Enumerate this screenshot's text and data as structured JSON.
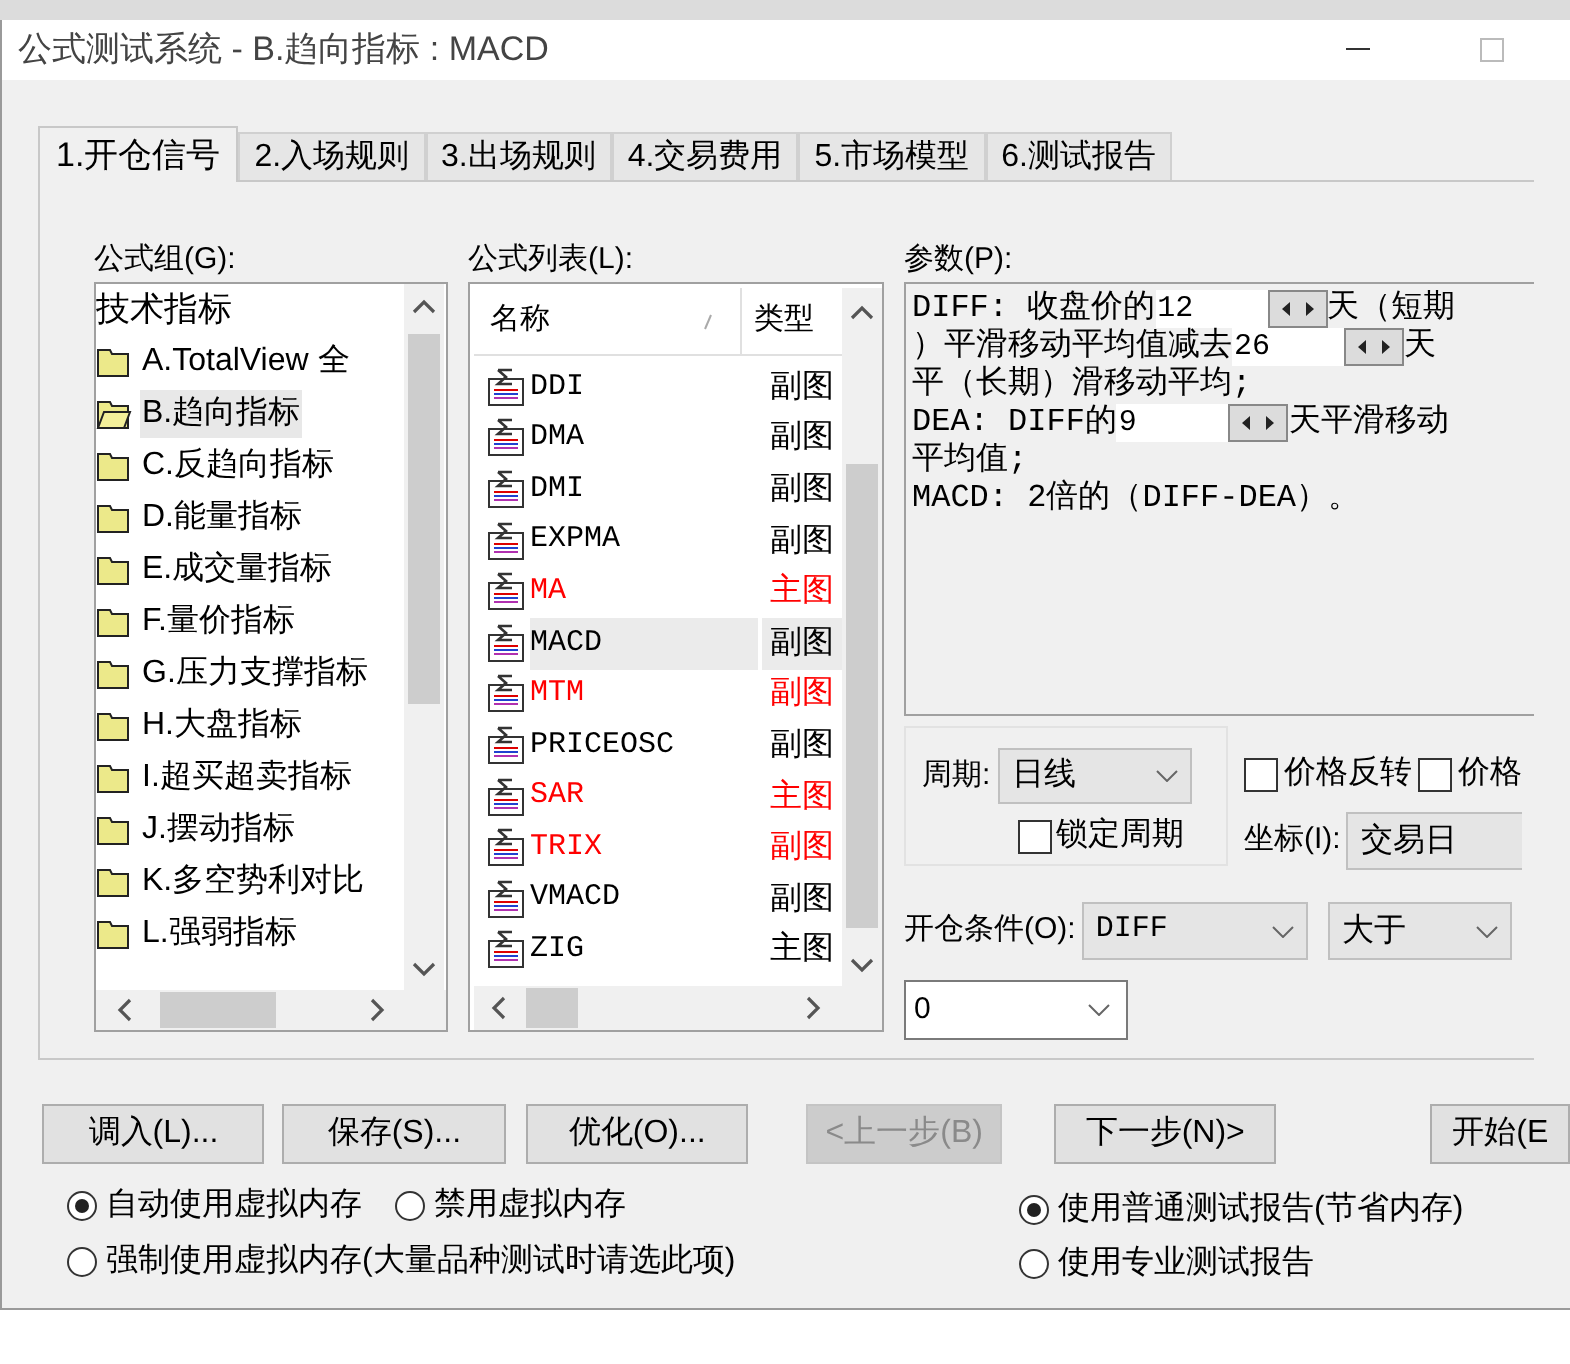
{
  "window": {
    "title": "公式测试系统 - B.趋向指标 : MACD"
  },
  "tabs": [
    {
      "label": "1.开仓信号",
      "selected": true
    },
    {
      "label": "2.入场规则",
      "selected": false
    },
    {
      "label": "3.出场规则",
      "selected": false
    },
    {
      "label": "4.交易费用",
      "selected": false
    },
    {
      "label": "5.市场模型",
      "selected": false
    },
    {
      "label": "6.测试报告",
      "selected": false
    }
  ],
  "formula_group": {
    "label": "公式组(G):",
    "header": "技术指标",
    "items": [
      {
        "label": "A.TotalView 全",
        "selected": false
      },
      {
        "label": "B.趋向指标",
        "selected": true
      },
      {
        "label": "C.反趋向指标",
        "selected": false
      },
      {
        "label": "D.能量指标",
        "selected": false
      },
      {
        "label": "E.成交量指标",
        "selected": false
      },
      {
        "label": "F.量价指标",
        "selected": false
      },
      {
        "label": "G.压力支撑指标",
        "selected": false
      },
      {
        "label": "H.大盘指标",
        "selected": false
      },
      {
        "label": "I.超买超卖指标",
        "selected": false
      },
      {
        "label": "J.摆动指标",
        "selected": false
      },
      {
        "label": "K.多空势利对比",
        "selected": false
      },
      {
        "label": "L.强弱指标",
        "selected": false
      }
    ]
  },
  "formula_list": {
    "label": "公式列表(L):",
    "columns": [
      "名称",
      "类型"
    ],
    "rows": [
      {
        "name": "DDI",
        "type": "副图",
        "color": "#000000",
        "selected": false
      },
      {
        "name": "DMA",
        "type": "副图",
        "color": "#000000",
        "selected": false
      },
      {
        "name": "DMI",
        "type": "副图",
        "color": "#000000",
        "selected": false
      },
      {
        "name": "EXPMA",
        "type": "副图",
        "color": "#000000",
        "selected": false
      },
      {
        "name": "MA",
        "type": "主图",
        "color": "#ff0000",
        "selected": false
      },
      {
        "name": "MACD",
        "type": "副图",
        "color": "#000000",
        "selected": true
      },
      {
        "name": "MTM",
        "type": "副图",
        "color": "#ff0000",
        "selected": false
      },
      {
        "name": "PRICEOSC",
        "type": "副图",
        "color": "#000000",
        "selected": false
      },
      {
        "name": "SAR",
        "type": "主图",
        "color": "#ff0000",
        "selected": false
      },
      {
        "name": "TRIX",
        "type": "副图",
        "color": "#ff0000",
        "selected": false
      },
      {
        "name": "VMACD",
        "type": "副图",
        "color": "#000000",
        "selected": false
      },
      {
        "name": "ZIG",
        "type": "主图",
        "color": "#000000",
        "selected": false
      }
    ]
  },
  "parameters": {
    "label": "参数(P):",
    "lines": [
      [
        {
          "kind": "text",
          "text": "DIFF: 收盘价的"
        },
        {
          "kind": "spin",
          "value": "12"
        },
        {
          "kind": "text",
          "text": "天（短期"
        }
      ],
      [
        {
          "kind": "text",
          "text": "）平滑移动平均值减去"
        },
        {
          "kind": "spin",
          "value": "26"
        },
        {
          "kind": "text",
          "text": "天"
        }
      ],
      [
        {
          "kind": "text",
          "text": "平（长期）滑移动平均;"
        }
      ],
      [
        {
          "kind": "text",
          "text": "DEA: DIFF的"
        },
        {
          "kind": "spin",
          "value": "9"
        },
        {
          "kind": "text",
          "text": "天平滑移动"
        }
      ],
      [
        {
          "kind": "text",
          "text": "平均值;"
        }
      ],
      [
        {
          "kind": "text",
          "text": "MACD: 2倍的（DIFF-DEA）。"
        }
      ]
    ]
  },
  "period": {
    "label": "周期:",
    "value": "日线",
    "lock": {
      "label": "锁定周期",
      "checked": false
    }
  },
  "options": [
    {
      "label": "价格反转",
      "checked": false
    },
    {
      "label": "价格",
      "checked": false
    }
  ],
  "coordinate": {
    "label": "坐标(I):",
    "value": "交易日"
  },
  "open_condition": {
    "label": "开仓条件(O):",
    "indicator": "DIFF",
    "operator": "大于",
    "threshold": "0"
  },
  "buttons": [
    {
      "label": "调入(L)...",
      "disabled": false
    },
    {
      "label": "保存(S)...",
      "disabled": false
    },
    {
      "label": "优化(O)...",
      "disabled": false
    },
    {
      "label": "<上一步(B)",
      "disabled": true
    },
    {
      "label": "下一步(N)>",
      "disabled": false
    },
    {
      "label": "开始(E",
      "disabled": false
    }
  ],
  "memory_options": [
    {
      "label": "自动使用虚拟内存",
      "selected": true
    },
    {
      "label": "禁用虚拟内存",
      "selected": false
    },
    {
      "label": "强制使用虚拟内存(大量品种测试时请选此项)",
      "selected": false
    }
  ],
  "report_options": [
    {
      "label": "使用普通测试报告(节省内存)",
      "selected": true
    },
    {
      "label": "使用专业测试报告",
      "selected": false
    }
  ]
}
